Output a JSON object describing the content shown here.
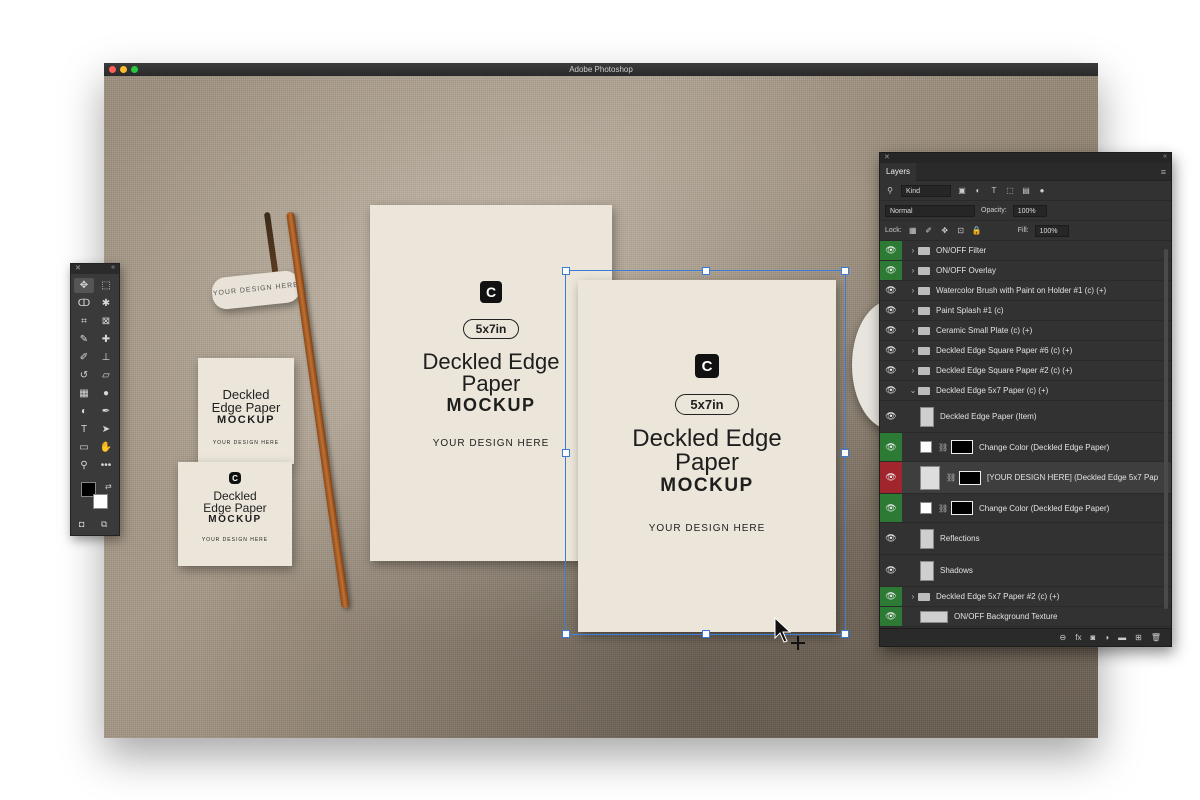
{
  "window": {
    "title": "Adobe Photoshop"
  },
  "colors": {
    "close": "#ff5f57",
    "minimize": "#febc2e",
    "zoom": "#28c840",
    "selection": "#3a7bd5",
    "visible": "#2d7a35",
    "active": "#a1252c"
  },
  "artwork": {
    "rest_text": "YOUR DESIGN HERE",
    "logo_letter": "C",
    "large_card": {
      "size": "5x7in",
      "title_line1": "Deckled Edge",
      "title_line2": "Paper",
      "title_bold": "MOCKUP",
      "footer": "YOUR DESIGN HERE"
    },
    "selected_card": {
      "size": "5x7in",
      "title_line1": "Deckled Edge",
      "title_line2": "Paper",
      "title_bold": "MOCKUP",
      "footer": "YOUR DESIGN HERE"
    },
    "small_card_1": {
      "title_line1": "Deckled",
      "title_line2": "Edge Paper",
      "title_bold": "MOCKUP",
      "footer": "YOUR DESIGN HERE"
    },
    "small_card_2": {
      "title_line1": "Deckled",
      "title_line2": "Edge Paper",
      "title_bold": "MOCKUP",
      "footer": "YOUR DESIGN HERE"
    }
  },
  "tools": [
    {
      "name": "move-tool",
      "glyph": "✥",
      "active": true
    },
    {
      "name": "marquee-tool",
      "glyph": "⬚"
    },
    {
      "name": "lasso-tool",
      "glyph": "ↀ"
    },
    {
      "name": "magic-wand-tool",
      "glyph": "✱"
    },
    {
      "name": "crop-tool",
      "glyph": "⌗"
    },
    {
      "name": "frame-tool",
      "glyph": "⊠"
    },
    {
      "name": "eyedropper-tool",
      "glyph": "✎"
    },
    {
      "name": "healing-tool",
      "glyph": "✚"
    },
    {
      "name": "brush-tool",
      "glyph": "✐"
    },
    {
      "name": "stamp-tool",
      "glyph": "⊥"
    },
    {
      "name": "history-brush-tool",
      "glyph": "↺"
    },
    {
      "name": "eraser-tool",
      "glyph": "▱"
    },
    {
      "name": "gradient-tool",
      "glyph": "▦"
    },
    {
      "name": "blur-tool",
      "glyph": "●"
    },
    {
      "name": "dodge-tool",
      "glyph": "◐"
    },
    {
      "name": "pen-tool",
      "glyph": "✒"
    },
    {
      "name": "type-tool",
      "glyph": "T"
    },
    {
      "name": "path-select-tool",
      "glyph": "➤"
    },
    {
      "name": "shape-tool",
      "glyph": "▭"
    },
    {
      "name": "hand-tool",
      "glyph": "✋"
    },
    {
      "name": "zoom-tool",
      "glyph": "⚲"
    },
    {
      "name": "more-tools",
      "glyph": "•••"
    }
  ],
  "layers_panel": {
    "tab": "Layers",
    "filter_kind": "Kind",
    "blend_mode": "Normal",
    "opacity_label": "Opacity:",
    "opacity_value": "100%",
    "lock_label": "Lock:",
    "fill_label": "Fill:",
    "fill_value": "100%",
    "layers": [
      {
        "name": "ON/OFF Filter",
        "type": "group",
        "eye": "green"
      },
      {
        "name": "ON/OFF Overlay",
        "type": "group",
        "eye": "green"
      },
      {
        "name": "Watercolor Brush with Paint on Holder #1 (c) (+)",
        "type": "group",
        "eye": "plain"
      },
      {
        "name": "Paint Splash #1 (c)",
        "type": "group",
        "eye": "plain"
      },
      {
        "name": "Ceramic Small Plate (c) (+)",
        "type": "group",
        "eye": "plain"
      },
      {
        "name": "Deckled Edge Square Paper #6 (c) (+)",
        "type": "group",
        "eye": "plain"
      },
      {
        "name": "Deckled Edge Square Paper #2 (c) (+)",
        "type": "group",
        "eye": "plain"
      },
      {
        "name": "Deckled Edge 5x7 Paper (c) (+)",
        "type": "group-open",
        "eye": "plain"
      },
      {
        "name": "Deckled Edge Paper (Item)",
        "type": "layer",
        "eye": "plain"
      },
      {
        "name": "Change Color (Deckled Edge Paper)",
        "type": "adjust",
        "eye": "green"
      },
      {
        "name": "[YOUR DESIGN HERE] (Deckled Edge 5x7 Pap",
        "type": "smart",
        "eye": "red"
      },
      {
        "name": "Change Color (Deckled Edge Paper)",
        "type": "adjust",
        "eye": "green"
      },
      {
        "name": "Reflections",
        "type": "layer",
        "eye": "plain"
      },
      {
        "name": "Shadows",
        "type": "layer",
        "eye": "plain"
      },
      {
        "name": "Deckled Edge 5x7 Paper #2 (c) (+)",
        "type": "group",
        "eye": "green"
      },
      {
        "name": "ON/OFF Background Texture",
        "type": "layer",
        "eye": "green"
      }
    ],
    "bottom_icons": [
      "⊖",
      "fx",
      "◙",
      "◑",
      "▬",
      "⊞",
      "🗑"
    ]
  }
}
